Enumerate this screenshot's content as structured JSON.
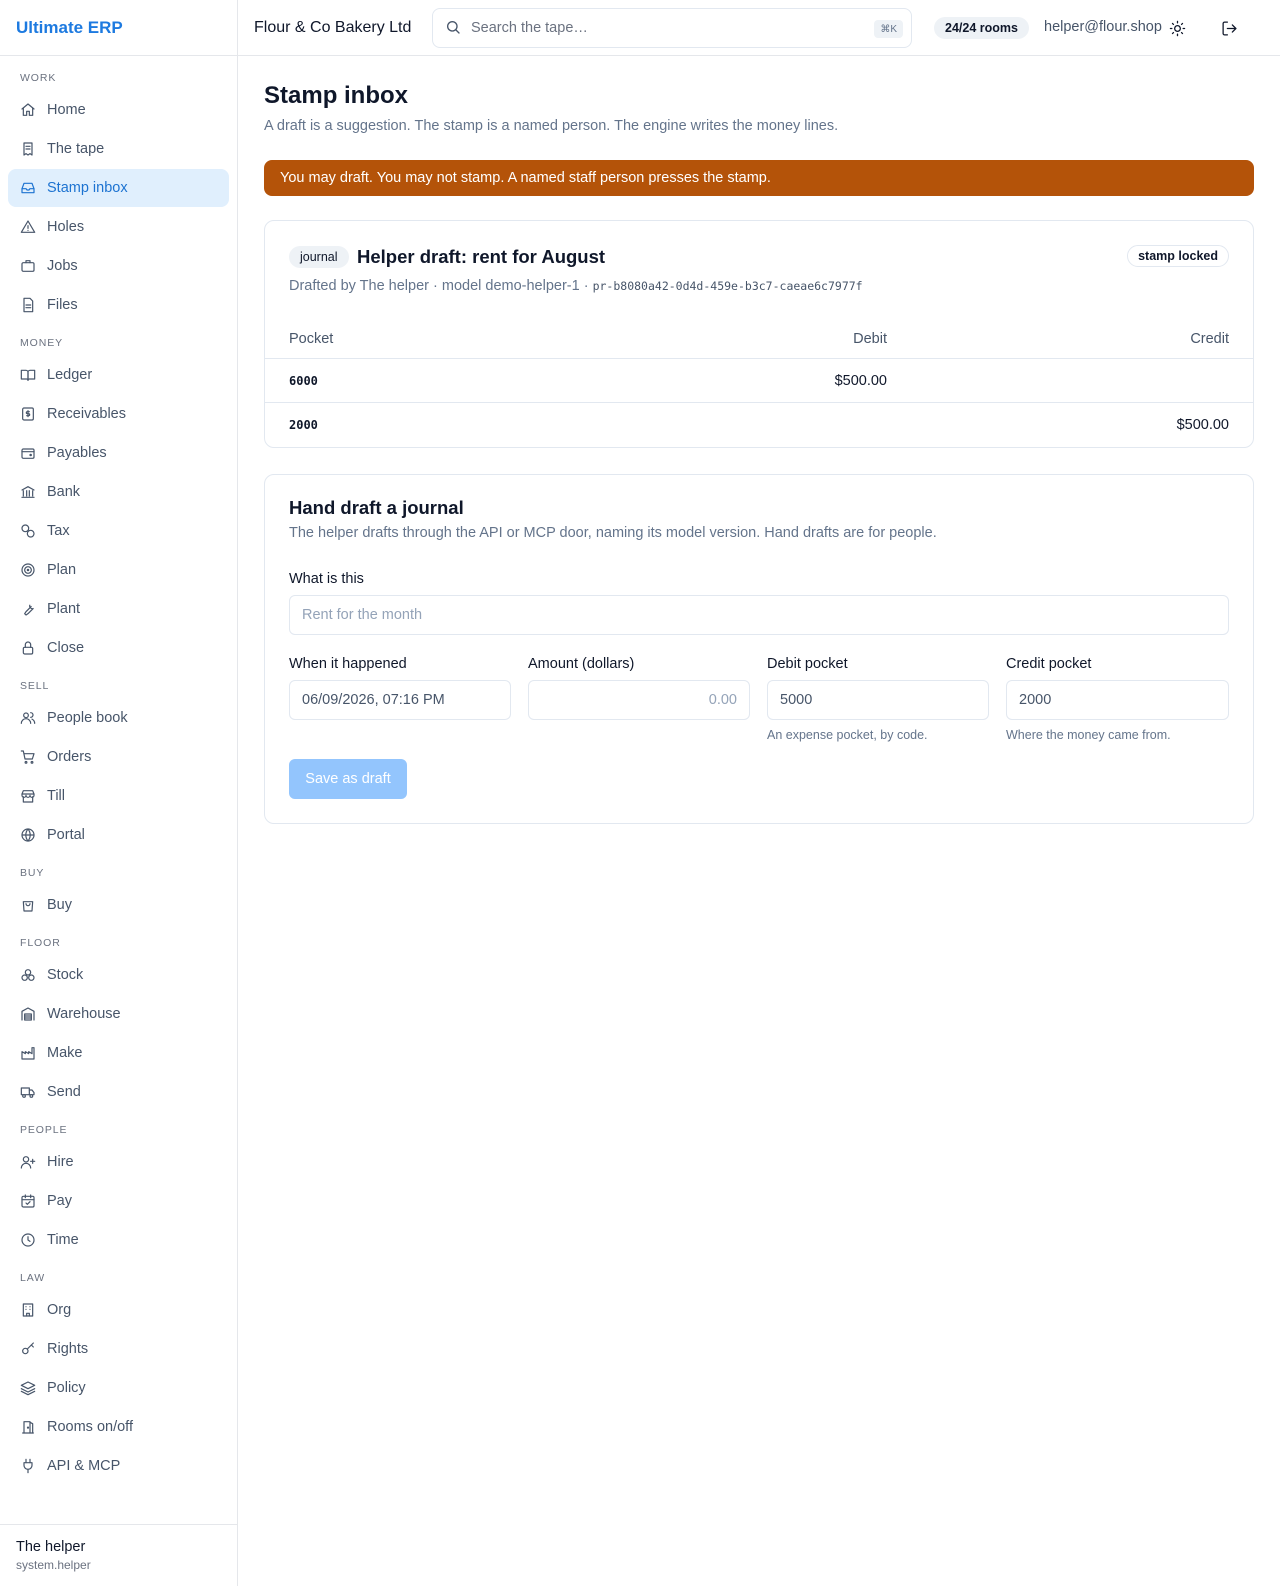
{
  "app": {
    "brand": "Ultimate ERP",
    "org_name": "Flour & Co Bakery Ltd",
    "search_placeholder": "Search the tape…",
    "search_shortcut": "⌘K",
    "rooms_badge": "24/24 rooms",
    "user_email": "helper@flour.shop",
    "accent_color": "#1d7ae0",
    "alert_color": "#b45309"
  },
  "sidebar": {
    "sections": [
      {
        "label": "WORK",
        "items": [
          {
            "label": "Home",
            "icon": "home-icon"
          },
          {
            "label": "The tape",
            "icon": "receipt-icon"
          },
          {
            "label": "Stamp inbox",
            "icon": "inbox-icon",
            "active": true
          },
          {
            "label": "Holes",
            "icon": "warning-triangle-icon"
          },
          {
            "label": "Jobs",
            "icon": "briefcase-icon"
          },
          {
            "label": "Files",
            "icon": "file-icon"
          }
        ]
      },
      {
        "label": "MONEY",
        "items": [
          {
            "label": "Ledger",
            "icon": "book-open-icon"
          },
          {
            "label": "Receivables",
            "icon": "dollar-receipt-icon"
          },
          {
            "label": "Payables",
            "icon": "wallet-icon"
          },
          {
            "label": "Bank",
            "icon": "bank-icon"
          },
          {
            "label": "Tax",
            "icon": "percent-coins-icon"
          },
          {
            "label": "Plan",
            "icon": "target-icon"
          },
          {
            "label": "Plant",
            "icon": "wrench-icon"
          },
          {
            "label": "Close",
            "icon": "lock-icon"
          }
        ]
      },
      {
        "label": "SELL",
        "items": [
          {
            "label": "People book",
            "icon": "users-icon"
          },
          {
            "label": "Orders",
            "icon": "cart-icon"
          },
          {
            "label": "Till",
            "icon": "store-icon"
          },
          {
            "label": "Portal",
            "icon": "globe-icon"
          }
        ]
      },
      {
        "label": "BUY",
        "items": [
          {
            "label": "Buy",
            "icon": "shopping-bag-icon"
          }
        ]
      },
      {
        "label": "FLOOR",
        "items": [
          {
            "label": "Stock",
            "icon": "boxes-icon"
          },
          {
            "label": "Warehouse",
            "icon": "warehouse-icon"
          },
          {
            "label": "Make",
            "icon": "factory-icon"
          },
          {
            "label": "Send",
            "icon": "truck-icon"
          }
        ]
      },
      {
        "label": "PEOPLE",
        "items": [
          {
            "label": "Hire",
            "icon": "user-plus-icon"
          },
          {
            "label": "Pay",
            "icon": "calendar-check-icon"
          },
          {
            "label": "Time",
            "icon": "clock-icon"
          }
        ]
      },
      {
        "label": "LAW",
        "items": [
          {
            "label": "Org",
            "icon": "building-icon"
          },
          {
            "label": "Rights",
            "icon": "key-icon"
          },
          {
            "label": "Policy",
            "icon": "layers-icon"
          },
          {
            "label": "Rooms on/off",
            "icon": "door-icon"
          },
          {
            "label": "API & MCP",
            "icon": "plug-icon"
          }
        ]
      }
    ],
    "footer": {
      "name": "The helper",
      "id": "system.helper"
    }
  },
  "page": {
    "title": "Stamp inbox",
    "subtitle": "A draft is a suggestion. The stamp is a named person. The engine writes the money lines.",
    "alert": "You may draft. You may not stamp. A named staff person presses the stamp."
  },
  "draft": {
    "tag": "journal",
    "title": "Helper draft: rent for August",
    "stamp_status": "stamp locked",
    "meta_text": "Drafted by The helper · model demo-helper-1 · ",
    "meta_id": "pr-b8080a42-0d4d-459e-b3c7-caeae6c7977f",
    "columns": {
      "pocket": "Pocket",
      "debit": "Debit",
      "credit": "Credit"
    },
    "lines": [
      {
        "pocket": "6000",
        "debit": "$500.00",
        "credit": ""
      },
      {
        "pocket": "2000",
        "debit": "",
        "credit": "$500.00"
      }
    ]
  },
  "form": {
    "title": "Hand draft a journal",
    "subtitle": "The helper drafts through the API or MCP door, naming its model version. Hand drafts are for people.",
    "what_label": "What is this",
    "what_placeholder": "Rent for the month",
    "when_label": "When it happened",
    "when_value": "06/09/2026, 07:16 PM",
    "amount_label": "Amount (dollars)",
    "amount_placeholder": "0.00",
    "debit_label": "Debit pocket",
    "debit_value": "5000",
    "debit_hint": "An expense pocket, by code.",
    "credit_label": "Credit pocket",
    "credit_value": "2000",
    "credit_hint": "Where the money came from.",
    "save_label": "Save as draft"
  }
}
